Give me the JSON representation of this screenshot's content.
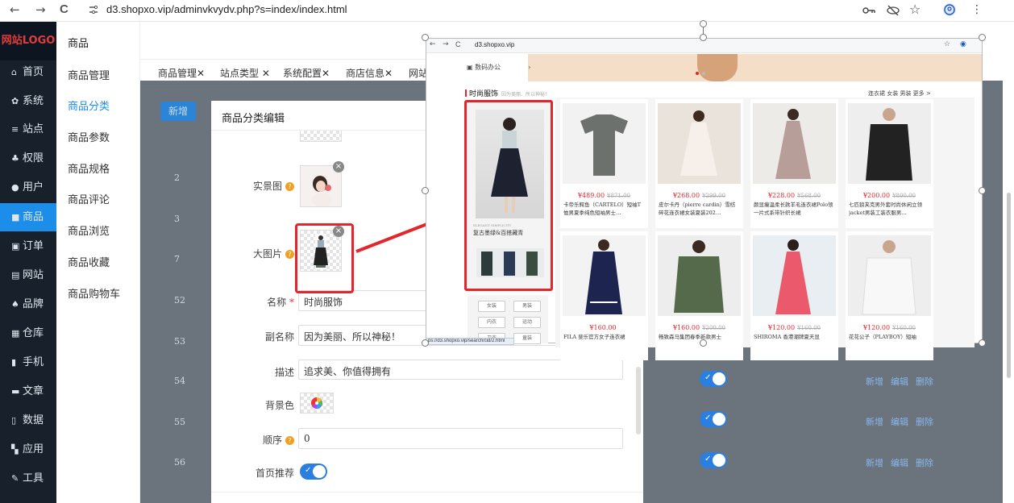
{
  "browser": {
    "url": "d3.shopxo.vip/adminvkvydv.php?s=index/index.html",
    "back": "←",
    "forward": "→",
    "reload": "C"
  },
  "admin": {
    "logo": "网站LOGO",
    "menu": [
      {
        "label": "首页",
        "icon": "⌂"
      },
      {
        "label": "系统",
        "icon": "✿"
      },
      {
        "label": "站点",
        "icon": "≡"
      },
      {
        "label": "权限",
        "icon": "♣"
      },
      {
        "label": "用户",
        "icon": "●"
      },
      {
        "label": "商品",
        "icon": "■"
      },
      {
        "label": "订单",
        "icon": "▣"
      },
      {
        "label": "网站",
        "icon": "▤"
      },
      {
        "label": "品牌",
        "icon": "♠"
      },
      {
        "label": "仓库",
        "icon": "▦"
      },
      {
        "label": "手机",
        "icon": "▮"
      },
      {
        "label": "文章",
        "icon": "▬"
      },
      {
        "label": "数据",
        "icon": "▯"
      },
      {
        "label": "应用",
        "icon": "▚"
      },
      {
        "label": "工具",
        "icon": "✎"
      }
    ],
    "sub_title": "商品",
    "sub_menu": [
      "商品管理",
      "商品分类",
      "商品参数",
      "商品规格",
      "商品评论",
      "商品浏览",
      "商品收藏",
      "商品购物车"
    ],
    "tabs": [
      "商品管理✕",
      "站点类型 ✕",
      "系统配置✕",
      "商店信息✕",
      "网站"
    ],
    "add_button": "新增",
    "row_ids": [
      "2",
      "3",
      "7",
      "52",
      "53",
      "54",
      "55",
      "56"
    ],
    "row_actions": {
      "add": "新增",
      "edit": "编辑",
      "del": "删除"
    }
  },
  "modal": {
    "title": "商品分类编辑",
    "fields": {
      "scene_image_label": "实景图",
      "big_image_label": "大图片",
      "name_label": "名称",
      "name_value": "时尚服饰",
      "subname_label": "副名称",
      "subname_value": "因为美丽、所以神秘！",
      "desc_label": "描述",
      "desc_value": "追求美、你值得拥有",
      "bgcolor_label": "背景色",
      "order_label": "顺序",
      "order_value": "0",
      "home_label": "首页推荐",
      "required_mark": "*",
      "help": "?"
    }
  },
  "preview": {
    "url": "d3.shopxo.vip",
    "menu_item": "数码办公",
    "section_title": "时尚服饰",
    "section_sub": "因为美丽、所以神秘！",
    "section_nav": "连衣裙  女装  男装  更多 >",
    "promo_small": "ELEGANT SIMPLICITY",
    "promo_text": "复古墨绿&百搭藏青",
    "tags": [
      "女装",
      "男装",
      "内衣",
      "运动",
      "卫衣",
      "童装"
    ],
    "status_url": "ps://d3.shopxo.vip/search/cid/2.html",
    "products": [
      {
        "price": "¥489.00",
        "old": "¥871.00",
        "name": "卡帝乐鳄鱼（CARTELO）短袖T恤男夏季纯色短袖男士…"
      },
      {
        "price": "¥268.00",
        "old": "¥299.00",
        "name": "皮尔卡丹（pierre cardin）雪纺碎花连衣裙女装夏装202…"
      },
      {
        "price": "¥228.00",
        "old": "¥568.00",
        "name": "颜显瘦温柔长款羊毛连衣裙Polo领一片式系带针织长裙"
      },
      {
        "price": "¥200.00",
        "old": "¥800.00",
        "name": "七匹狼夹克男外套时尚休闲立领jacket男装工装衣服男…"
      },
      {
        "price": "¥160.00",
        "old": "",
        "name": "FILA 斐乐官方女子连衣裙"
      },
      {
        "price": "¥160.00",
        "old": "¥200.00",
        "name": "畅致森马集团春季新款男士"
      },
      {
        "price": "¥120.00",
        "old": "¥160.00",
        "name": "SHIROMA 香港潮牌夏天显"
      },
      {
        "price": "¥120.00",
        "old": "¥160.00",
        "name": "花花公子（PLAYBOY）短袖"
      }
    ]
  },
  "colors": {
    "accent": "#1c8ee9",
    "highlight": "#e3262c",
    "sidebar": "#17202b"
  }
}
